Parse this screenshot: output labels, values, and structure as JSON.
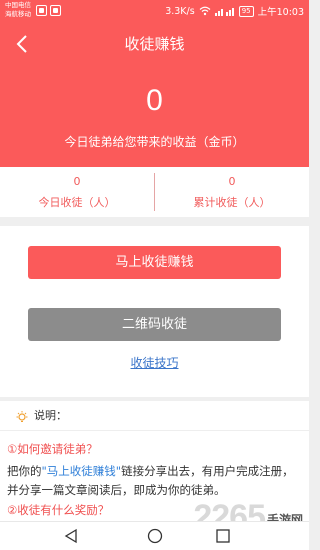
{
  "status_bar": {
    "carrier_line1": "中国电信",
    "carrier_line2": "海航移动",
    "speed": "3.3K/s",
    "battery": "95",
    "time": "上午10:03"
  },
  "header": {
    "title": "收徒赚钱",
    "today_income_value": "0",
    "today_income_label": "今日徒弟给您带来的收益（金币）"
  },
  "stats": {
    "today_count_value": "0",
    "today_count_label": "今日收徒（人）",
    "total_count_value": "0",
    "total_count_label": "累计收徒（人）"
  },
  "actions": {
    "primary_label": "马上收徒赚钱",
    "qr_label": "二维码收徒",
    "tips_link": "收徒技巧"
  },
  "notes": {
    "title": "说明：",
    "q1": "①如何邀请徒弟？",
    "a1_before": "把你的",
    "a1_highlight": "\"马上收徒赚钱\"",
    "a1_after": "链接分享出去，有用户完成注册，并分享一篇文章阅读后，即成为你的徒弟。",
    "q2": "②收徒有什么奖励？"
  },
  "watermark": {
    "logo": "2265",
    "text": "手游网"
  },
  "colors": {
    "brand_red": "#fb5a5a",
    "gray_button": "#8c8c8c",
    "link_blue": "#3a74c9"
  }
}
